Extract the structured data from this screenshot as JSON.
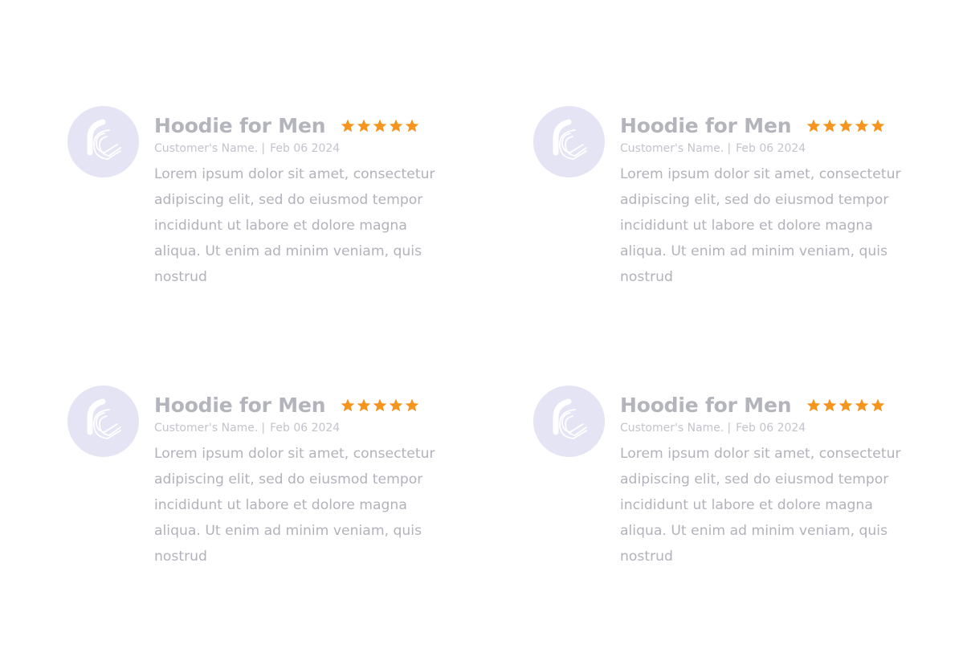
{
  "colors": {
    "star": "#f7941d",
    "avatar_bg": "#e4e4f4",
    "title": "#b4b4bd",
    "text": "#b2b2bb"
  },
  "reviews": [
    {
      "avatar_icon": "brand-logo-icon",
      "title": "Hoodie for Men",
      "rating": 5,
      "customer": "Customer's Name.",
      "separator": "|",
      "date": "Feb 06 2024",
      "text": "Lorem ipsum dolor sit amet, consectetur adipiscing elit, sed do eiusmod tempor incididunt ut labore et dolore magna aliqua. Ut enim ad minim veniam, quis nostrud"
    },
    {
      "avatar_icon": "brand-logo-icon",
      "title": "Hoodie for Men",
      "rating": 5,
      "customer": "Customer's Name.",
      "separator": "|",
      "date": "Feb 06 2024",
      "text": "Lorem ipsum dolor sit amet, consectetur adipiscing elit, sed do eiusmod tempor incididunt ut labore et dolore magna aliqua. Ut enim ad minim veniam, quis nostrud"
    },
    {
      "avatar_icon": "brand-logo-icon",
      "title": "Hoodie for Men",
      "rating": 5,
      "customer": "Customer's Name.",
      "separator": "|",
      "date": "Feb 06 2024",
      "text": "Lorem ipsum dolor sit amet, consectetur adipiscing elit, sed do eiusmod tempor incididunt ut labore et dolore magna aliqua. Ut enim ad minim veniam, quis nostrud"
    },
    {
      "avatar_icon": "brand-logo-icon",
      "title": "Hoodie for Men",
      "rating": 5,
      "customer": "Customer's Name.",
      "separator": "|",
      "date": "Feb 06 2024",
      "text": "Lorem ipsum dolor sit amet, consectetur adipiscing elit, sed do eiusmod tempor incididunt ut labore et dolore magna aliqua. Ut enim ad minim veniam, quis nostrud"
    }
  ]
}
